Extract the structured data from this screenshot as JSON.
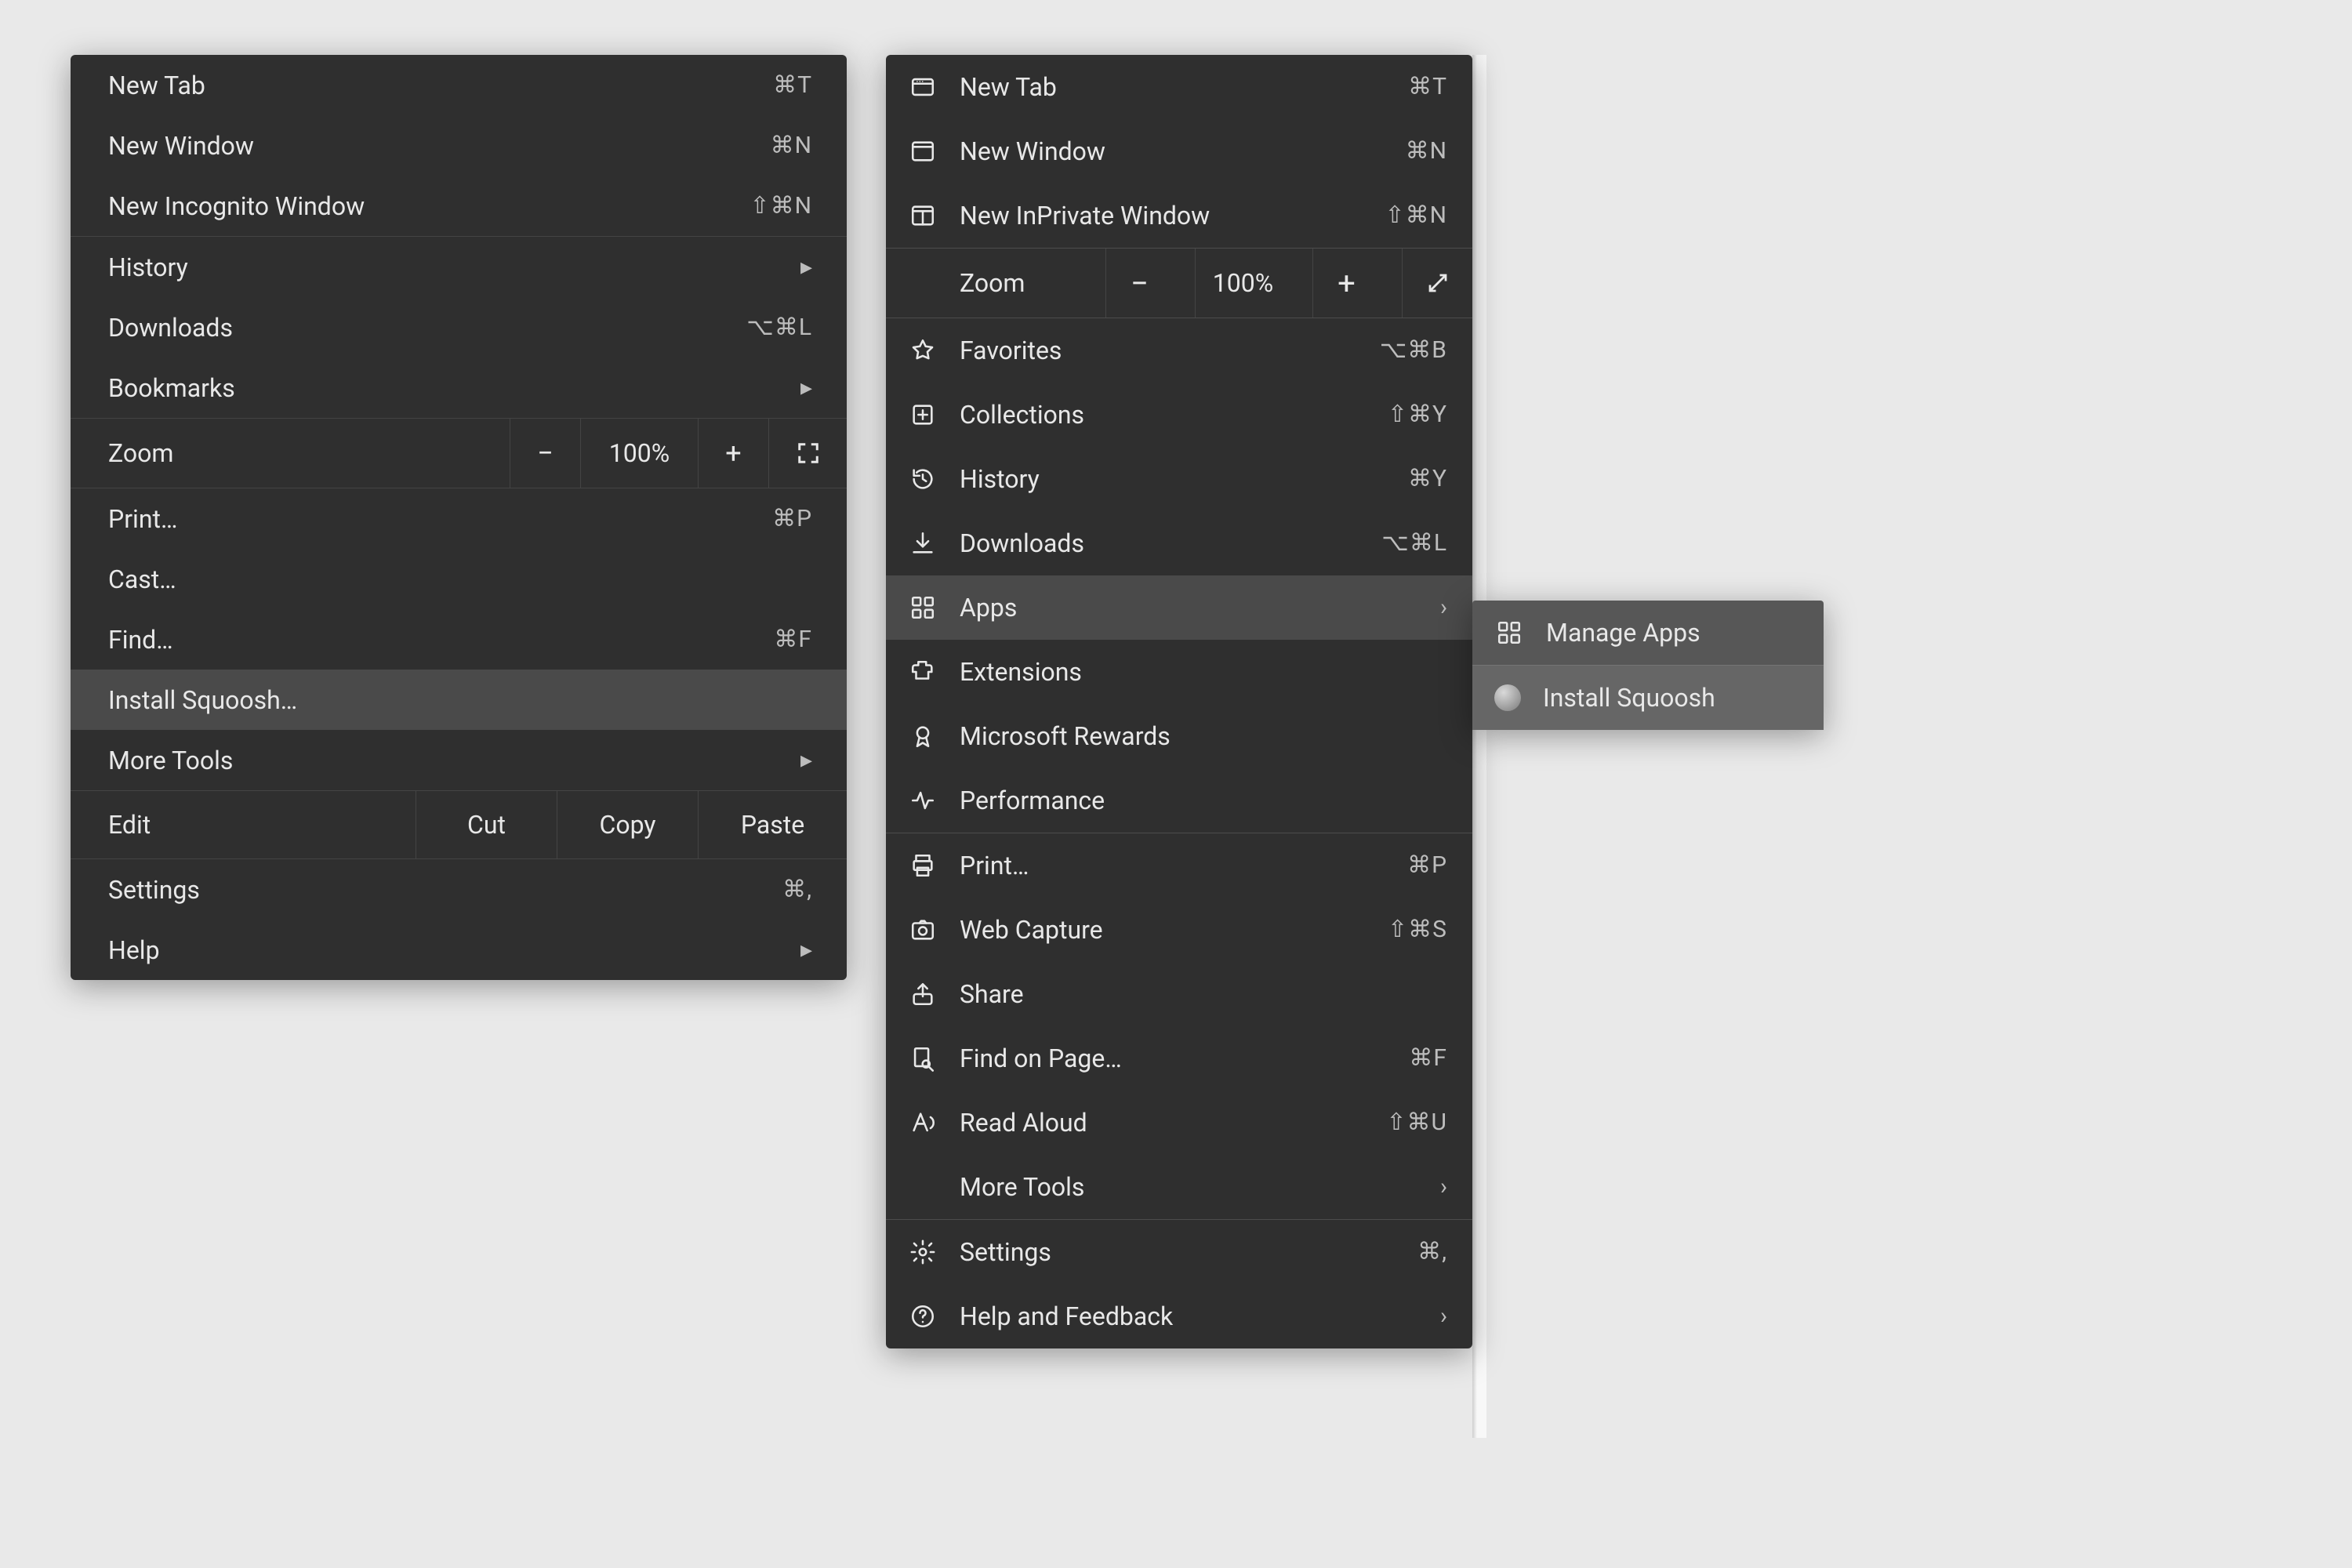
{
  "chrome": {
    "newTab": "New Tab",
    "newTab_sc": "⌘T",
    "newWindow": "New Window",
    "newWindow_sc": "⌘N",
    "newIncognito": "New Incognito Window",
    "newIncognito_sc": "⇧⌘N",
    "history": "History",
    "downloads": "Downloads",
    "downloads_sc": "⌥⌘L",
    "bookmarks": "Bookmarks",
    "zoom": "Zoom",
    "zoom_minus": "−",
    "zoom_val": "100%",
    "zoom_plus": "+",
    "print": "Print…",
    "print_sc": "⌘P",
    "cast": "Cast…",
    "find": "Find…",
    "find_sc": "⌘F",
    "install": "Install Squoosh…",
    "moreTools": "More Tools",
    "edit": "Edit",
    "cut": "Cut",
    "copy": "Copy",
    "paste": "Paste",
    "settings": "Settings",
    "settings_sc": "⌘,",
    "help": "Help"
  },
  "edge": {
    "newTab": "New Tab",
    "newTab_sc": "⌘T",
    "newWindow": "New Window",
    "newWindow_sc": "⌘N",
    "newInPrivate": "New InPrivate Window",
    "newInPrivate_sc": "⇧⌘N",
    "zoom": "Zoom",
    "zoom_minus": "−",
    "zoom_val": "100%",
    "zoom_plus": "+",
    "favorites": "Favorites",
    "favorites_sc": "⌥⌘B",
    "collections": "Collections",
    "collections_sc": "⇧⌘Y",
    "history": "History",
    "history_sc": "⌘Y",
    "downloads": "Downloads",
    "downloads_sc": "⌥⌘L",
    "apps": "Apps",
    "extensions": "Extensions",
    "rewards": "Microsoft Rewards",
    "performance": "Performance",
    "print": "Print…",
    "print_sc": "⌘P",
    "webCapture": "Web Capture",
    "webCapture_sc": "⇧⌘S",
    "share": "Share",
    "findOnPage": "Find on Page…",
    "findOnPage_sc": "⌘F",
    "readAloud": "Read Aloud",
    "readAloud_sc": "⇧⌘U",
    "moreTools": "More Tools",
    "settings": "Settings",
    "settings_sc": "⌘,",
    "helpFeedback": "Help and Feedback"
  },
  "appsSub": {
    "manage": "Manage Apps",
    "install": "Install Squoosh"
  },
  "glyphs": {
    "chevron": "▸",
    "chevronThin": "›"
  }
}
